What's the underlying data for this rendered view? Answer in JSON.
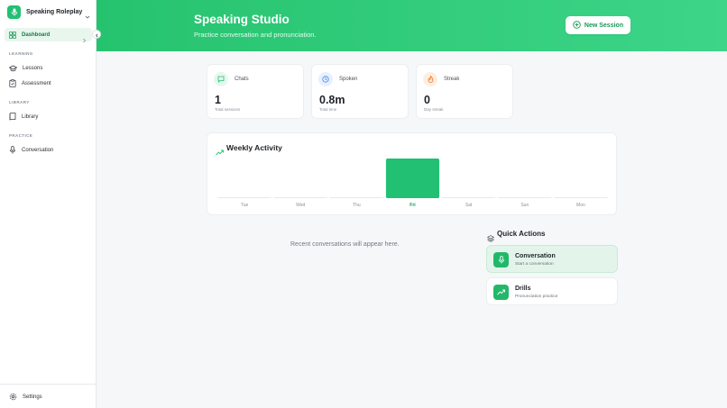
{
  "sidebar": {
    "brand": {
      "name": "Speaking Roleplay",
      "icon": "microphone-icon"
    },
    "nav": {
      "dashboard": {
        "label": "Dashboard",
        "icon": "grid-icon"
      },
      "sections": {
        "learning": "LEARNING",
        "library": "LIBRARY",
        "practice": "PRACTICE"
      },
      "lessons": {
        "label": "Lessons",
        "icon": "graduation-cap-icon"
      },
      "assessment": {
        "label": "Assessment",
        "icon": "clipboard-icon"
      },
      "library": {
        "label": "Library",
        "icon": "book-icon"
      },
      "conversation": {
        "label": "Conversation",
        "icon": "microphone-icon"
      }
    },
    "footer": {
      "settings": {
        "label": "Settings",
        "icon": "gear-icon"
      }
    }
  },
  "hero": {
    "title": "Speaking Studio",
    "subtitle": "Practice conversation and pronunciation.",
    "new_session_label": "New Session"
  },
  "stats": [
    {
      "label": "Chats",
      "value": "1",
      "caption": "Total sessions",
      "icon": "chat-icon",
      "color": "#22c073"
    },
    {
      "label": "Spoken",
      "value": "0.8m",
      "caption": "Total time",
      "icon": "clock-icon",
      "color": "#3b82f6"
    },
    {
      "label": "Streak",
      "value": "0",
      "caption": "Day streak",
      "icon": "flame-icon",
      "color": "#f97316"
    }
  ],
  "weekly_activity": {
    "title": "Weekly Activity",
    "icon": "trending-up-icon"
  },
  "chart_data": {
    "type": "bar",
    "categories": [
      "Tue",
      "Wed",
      "Thu",
      "Fri",
      "Sat",
      "Sun",
      "Mon"
    ],
    "values": [
      0,
      0,
      0,
      1,
      0,
      0,
      0
    ],
    "highlight": "Fri",
    "ylim": [
      0,
      1
    ],
    "grid": false,
    "bar_color": "#22c073",
    "baseline_color": "#e6e8eb"
  },
  "recent": {
    "empty_text": "Recent conversations will appear here."
  },
  "quick_actions": {
    "title": "Quick Actions",
    "icon": "layers-icon",
    "items": [
      {
        "name": "Conversation",
        "desc": "Start a conversation",
        "icon": "microphone-icon"
      },
      {
        "name": "Drills",
        "desc": "Pronunciation practice",
        "icon": "trending-up-icon"
      }
    ]
  },
  "colors": {
    "accent": "#22c073",
    "accent_dark": "#169a55"
  }
}
